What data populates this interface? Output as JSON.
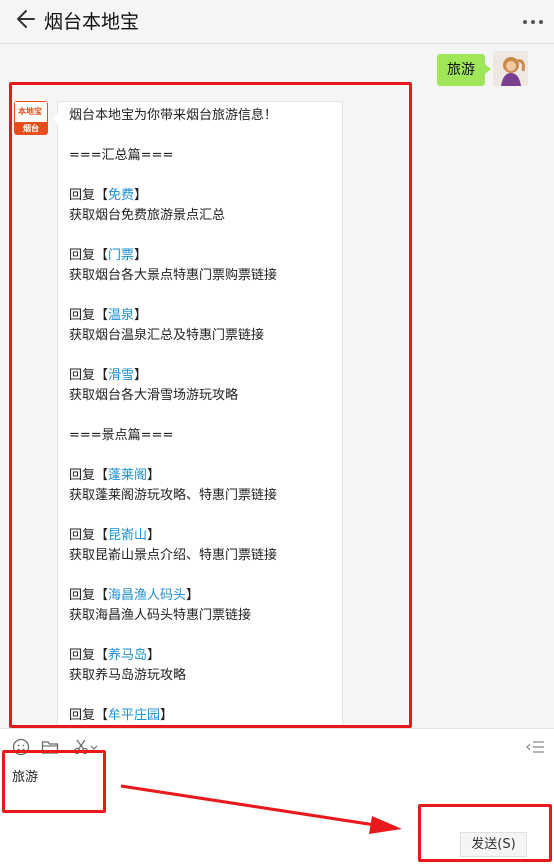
{
  "header": {
    "title": "烟台本地宝"
  },
  "chat": {
    "outgoing_message": "旅游",
    "bot_avatar": {
      "brand_text": "本地宝",
      "city_text": "烟台"
    },
    "message_lines": [
      {
        "type": "text",
        "text": "烟台本地宝为你带来烟台旅游信息！"
      },
      {
        "type": "blank"
      },
      {
        "type": "text",
        "text": "===汇总篇==="
      },
      {
        "type": "blank"
      },
      {
        "type": "reply",
        "prefix": "回复【",
        "keyword": "免费",
        "suffix": "】"
      },
      {
        "type": "text",
        "text": "获取烟台免费旅游景点汇总"
      },
      {
        "type": "blank"
      },
      {
        "type": "reply",
        "prefix": "回复【",
        "keyword": "门票",
        "suffix": "】"
      },
      {
        "type": "text",
        "text": "获取烟台各大景点特惠门票购票链接"
      },
      {
        "type": "blank"
      },
      {
        "type": "reply",
        "prefix": "回复【",
        "keyword": "温泉",
        "suffix": "】"
      },
      {
        "type": "text",
        "text": "获取烟台温泉汇总及特惠门票链接"
      },
      {
        "type": "blank"
      },
      {
        "type": "reply",
        "prefix": "回复【",
        "keyword": "滑雪",
        "suffix": "】"
      },
      {
        "type": "text",
        "text": "获取烟台各大滑雪场游玩攻略"
      },
      {
        "type": "blank"
      },
      {
        "type": "text",
        "text": "===景点篇==="
      },
      {
        "type": "blank"
      },
      {
        "type": "reply",
        "prefix": "回复【",
        "keyword": "蓬莱阁",
        "suffix": "】"
      },
      {
        "type": "text",
        "text": "获取蓬莱阁游玩攻略、特惠门票链接"
      },
      {
        "type": "blank"
      },
      {
        "type": "reply",
        "prefix": "回复【",
        "keyword": "昆嵛山",
        "suffix": "】"
      },
      {
        "type": "text",
        "text": "获取昆嵛山景点介绍、特惠门票链接"
      },
      {
        "type": "blank"
      },
      {
        "type": "reply",
        "prefix": "回复【",
        "keyword": "海昌渔人码头",
        "suffix": "】"
      },
      {
        "type": "text",
        "text": "获取海昌渔人码头特惠门票链接"
      },
      {
        "type": "blank"
      },
      {
        "type": "reply",
        "prefix": "回复【",
        "keyword": "养马岛",
        "suffix": "】"
      },
      {
        "type": "text",
        "text": "获取养马岛游玩攻略"
      },
      {
        "type": "blank"
      },
      {
        "type": "reply",
        "prefix": "回复【",
        "keyword": "牟平庄园",
        "suffix": "】"
      }
    ]
  },
  "composer": {
    "input_value": "旅游",
    "send_label": "发送(S)",
    "toolbar_icons": [
      "emoji-icon",
      "folder-icon",
      "scissors-icon",
      "history-icon"
    ]
  },
  "colors": {
    "bubble_green": "#9fe658",
    "keyword_blue": "#1a8fd6",
    "highlight_red": "#e8191d",
    "brand_orange": "#e84e1b"
  }
}
